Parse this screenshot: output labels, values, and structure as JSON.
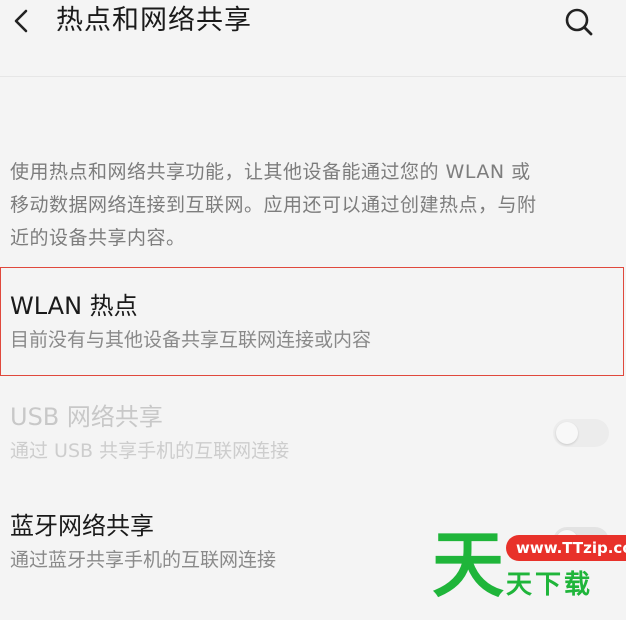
{
  "header": {
    "title": "热点和网络共享"
  },
  "description": {
    "lines": [
      "使用热点和网络共享功能，让其他设备能通过您的 WLAN 或",
      "移动数据网络连接到互联网。应用还可以通过创建热点，与附",
      "近的设备共享内容。"
    ]
  },
  "rows": [
    {
      "title": "WLAN 热点",
      "subtitle": "目前没有与其他设备共享互联网连接或内容",
      "enabled": true
    },
    {
      "title": "USB 网络共享",
      "subtitle": "通过 USB 共享手机的互联网连接",
      "enabled": false,
      "toggle_on": false
    },
    {
      "title": "蓝牙网络共享",
      "subtitle": "通过蓝牙共享手机的互联网连接",
      "enabled": true,
      "toggle_on": false
    }
  ],
  "icons": {
    "back": "chevron-left-icon",
    "search": "search-icon"
  },
  "colors": {
    "highlight_border": "#e0483c",
    "watermark_green": "#1fb53a",
    "watermark_red": "#e8312a"
  },
  "watermark": {
    "big_char": "天",
    "url": "www.TTzip.com",
    "text": "天下载"
  }
}
